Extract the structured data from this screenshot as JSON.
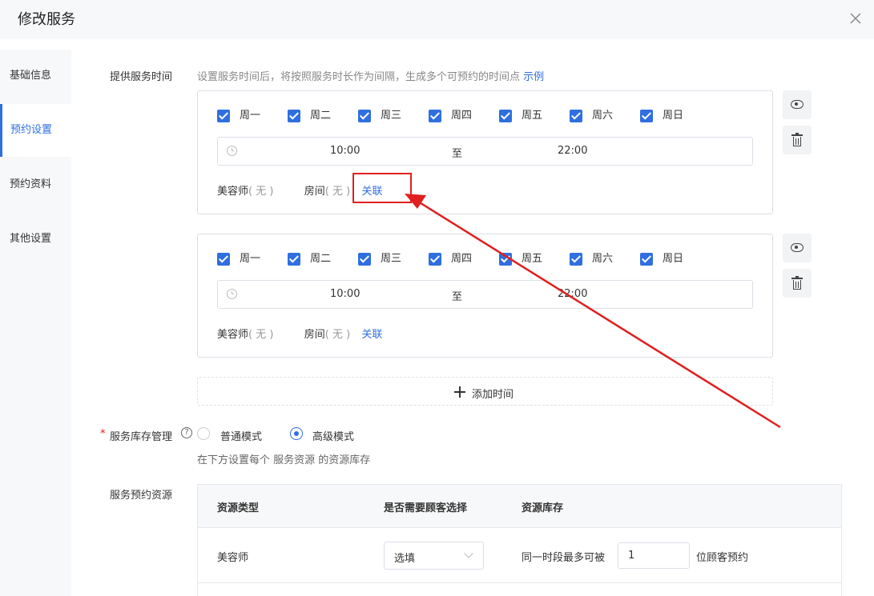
{
  "dialog": {
    "title": "修改服务",
    "close_icon": "close-icon"
  },
  "sidebar": {
    "items": [
      {
        "label": "基础信息",
        "active": false
      },
      {
        "label": "预约设置",
        "active": true
      },
      {
        "label": "预约资料",
        "active": false
      },
      {
        "label": "其他设置",
        "active": false
      }
    ]
  },
  "service_time": {
    "label": "提供服务时间",
    "hint": "设置服务时间后，将按照服务时长作为间隔，生成多个可预约的时间点",
    "example_link": "示例",
    "slots": [
      {
        "days": [
          "周一",
          "周二",
          "周三",
          "周四",
          "周五",
          "周六",
          "周日"
        ],
        "start": "10:00",
        "to": "至",
        "end": "22:00",
        "beautician_label": "美容师",
        "beautician_value": "( 无 )",
        "room_label": "房间",
        "room_value": "( 无 )",
        "link_label": "关联"
      },
      {
        "days": [
          "周一",
          "周二",
          "周三",
          "周四",
          "周五",
          "周六",
          "周日"
        ],
        "start": "10:00",
        "to": "至",
        "end": "22:00",
        "beautician_label": "美容师",
        "beautician_value": "( 无 )",
        "room_label": "房间",
        "room_value": "( 无 )",
        "link_label": "关联"
      }
    ],
    "add_label": "添加时间"
  },
  "inventory": {
    "required_mark": "*",
    "label": "服务库存管理",
    "help_icon": "?",
    "options": [
      {
        "label": "普通模式",
        "selected": false
      },
      {
        "label": "高级模式",
        "selected": true
      }
    ],
    "hint": "在下方设置每个 服务资源 的资源库存"
  },
  "resources": {
    "label": "服务预约资源",
    "columns": [
      "资源类型",
      "是否需要顾客选择",
      "资源库存"
    ],
    "rows": [
      {
        "type": "美容师",
        "select_value": "选填",
        "stock_prefix": "同一时段最多可被",
        "stock_value": "1",
        "stock_suffix": "位顾客预约"
      }
    ]
  },
  "annotation": {
    "highlight_color": "#e02020"
  }
}
